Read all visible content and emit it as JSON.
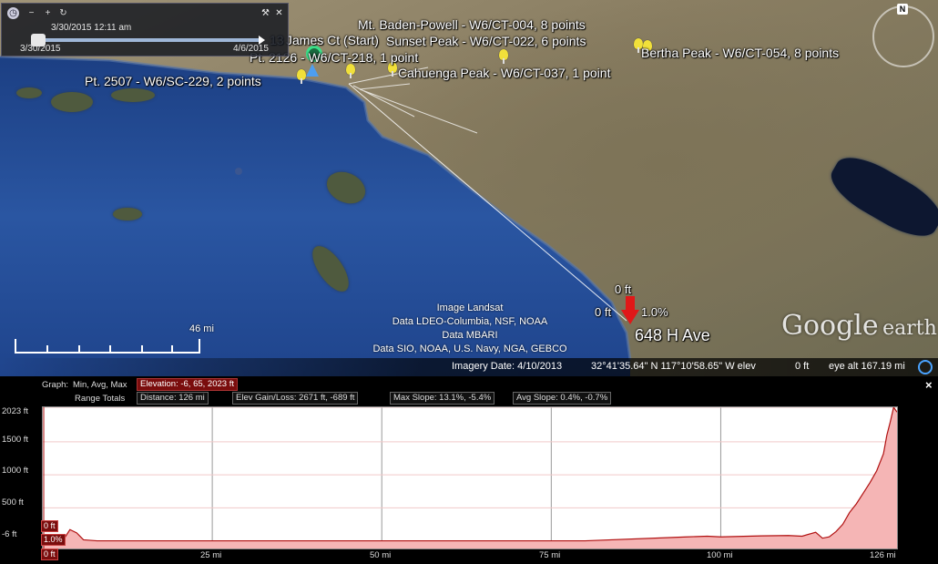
{
  "time_slider": {
    "start_label": "3/30/2015",
    "current_label": "3/30/2015  12:11 am",
    "end_label": "4/6/2015"
  },
  "markers": {
    "baden_powell": "Mt. Baden-Powell - W6/CT-004, 8 points",
    "sunset_peak": "Sunset Peak - W6/CT-022, 6 points",
    "bertha_peak": "Bertha Peak - W6/CT-054, 8 points",
    "james_ct": "James Ct (Start)",
    "james_ct_prefix": "13",
    "pt_2126": "Pt. 2126 - W6/CT-218, 1 point",
    "cahuenga_peak": "Cahuenga Peak - W6/CT-037, 1 point",
    "pt_2507": "Pt. 2507 - W6/SC-229, 2 points",
    "destination": "648 H Ave",
    "dest_elev_top": "0 ft",
    "dest_elev_left": "0 ft",
    "dest_slope": "1.0%"
  },
  "compass": {
    "north": "N"
  },
  "attribution": {
    "line1": "Image Landsat",
    "line2": "Data LDEO-Columbia, NSF, NOAA",
    "line3": "Data MBARI",
    "line4": "Data SIO, NOAA, U.S. Navy, NGA, GEBCO"
  },
  "scale": {
    "label": "46 mi"
  },
  "logo": {
    "word1": "Google",
    "word2": "earth"
  },
  "status": {
    "imagery_date": "Imagery Date: 4/10/2013",
    "coords": "32°41'35.64\" N  117°10'58.65\" W  elev",
    "elev": "0 ft",
    "eye_alt": "eye alt 167.19 mi"
  },
  "profile": {
    "graph_label": "Graph:",
    "graph_modes": "Min, Avg, Max",
    "elevation": "Elevation: -6, 65, 2023 ft",
    "range_totals_label": "Range Totals",
    "distance": "Distance: 126 mi",
    "elev_gain_loss": "Elev Gain/Loss: 2671 ft, -689 ft",
    "max_slope": "Max Slope: 13.1%, -5.4%",
    "avg_slope": "Avg Slope: 0.4%, -0.7%",
    "close": "×",
    "cursor_elev": "0 ft",
    "cursor_slope": "1.0%",
    "cursor_x": "0 ft"
  },
  "chart_data": {
    "type": "area",
    "xlabel": "",
    "ylabel": "",
    "x_unit": "mi",
    "y_unit": "ft",
    "x_ticks": [
      "25 mi",
      "50 mi",
      "75 mi",
      "100 mi",
      "126 mi"
    ],
    "x_tick_values": [
      25,
      50,
      75,
      100,
      126
    ],
    "y_ticks": [
      "2023 ft",
      "1500 ft",
      "1000 ft",
      "500 ft",
      "-6 ft"
    ],
    "y_tick_values": [
      2023,
      1500,
      1000,
      500,
      -6
    ],
    "xlim": [
      0,
      126
    ],
    "ylim": [
      -6,
      2023
    ],
    "grid": true,
    "fill_color": "#f5b5b5",
    "line_color": "#b01010",
    "x": [
      0,
      3,
      4,
      5,
      6,
      8,
      20,
      40,
      60,
      80,
      95,
      98,
      100,
      106,
      110,
      112,
      114,
      115,
      116,
      117,
      118,
      119,
      120,
      121,
      122,
      123,
      124,
      124.5,
      125,
      125.5,
      126
    ],
    "y": [
      10,
      10,
      170,
      120,
      15,
      0,
      0,
      0,
      0,
      0,
      60,
      70,
      60,
      75,
      80,
      70,
      130,
      40,
      60,
      140,
      250,
      430,
      560,
      720,
      880,
      1060,
      1320,
      1600,
      1800,
      2023,
      1950
    ]
  }
}
